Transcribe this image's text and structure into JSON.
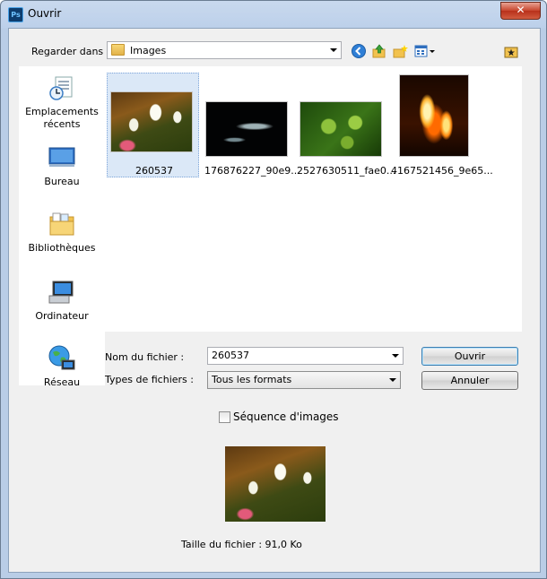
{
  "window": {
    "title": "Ouvrir",
    "app_icon_label": "Ps",
    "close_symbol": "✕"
  },
  "lookin": {
    "label": "Regarder dans :",
    "value": "Images"
  },
  "toolbar": {
    "icons": [
      "back-icon",
      "up-folder-icon",
      "new-folder-icon",
      "view-menu-icon",
      "favorite-folder-icon"
    ]
  },
  "places": [
    {
      "label": "Emplacements récents",
      "icon": "recent-places-icon"
    },
    {
      "label": "Bureau",
      "icon": "desktop-icon"
    },
    {
      "label": "Bibliothèques",
      "icon": "libraries-icon"
    },
    {
      "label": "Ordinateur",
      "icon": "computer-icon"
    },
    {
      "label": "Réseau",
      "icon": "network-icon"
    }
  ],
  "files": [
    {
      "name": "260537",
      "selected": true
    },
    {
      "name": "176876227_90e9...",
      "selected": false
    },
    {
      "name": "2527630511_fae0...",
      "selected": false
    },
    {
      "name": "4167521456_9e65...",
      "selected": false
    }
  ],
  "filename": {
    "label": "Nom du fichier :",
    "value": "260537"
  },
  "filetype": {
    "label": "Types de fichiers :",
    "value": "Tous les formats"
  },
  "buttons": {
    "open": "Ouvrir",
    "cancel": "Annuler"
  },
  "sequence": {
    "label": "Séquence d'images",
    "checked": false
  },
  "filesize": {
    "text": "Taille du fichier : 91,0 Ko"
  },
  "colors": {
    "title_gradient_top": "#c9d9ee",
    "close_red": "#c7452c",
    "selection": "#dbe8f7"
  }
}
